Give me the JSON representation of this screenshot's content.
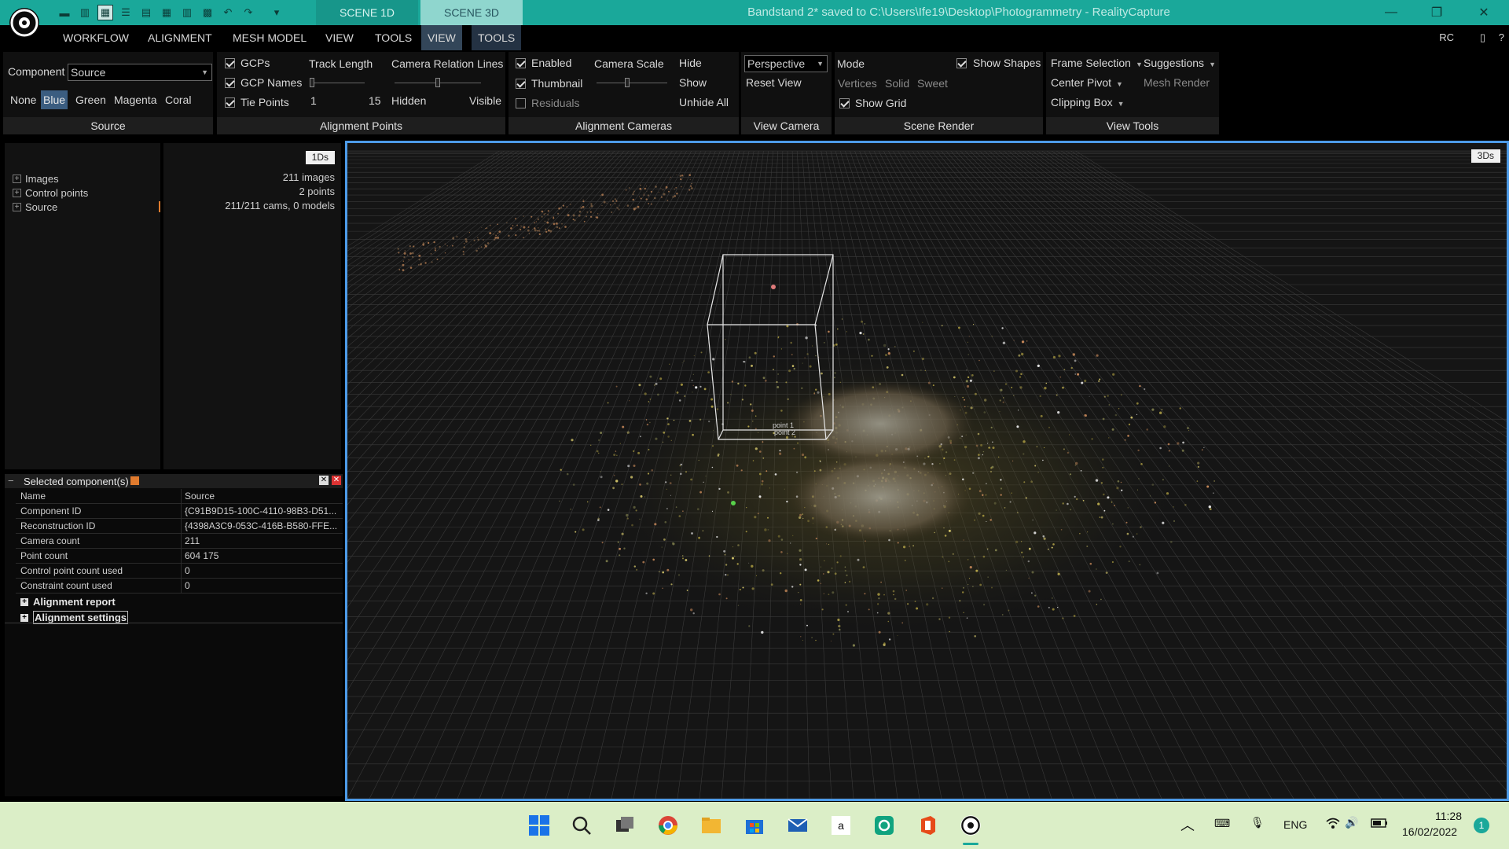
{
  "titlebar": {
    "scene_tabs": [
      "SCENE 1D",
      "SCENE 3D"
    ],
    "title": "Bandstand 2* saved to C:\\Users\\Ife19\\Desktop\\Photogrammetry - RealityCapture",
    "window_controls": [
      "minimize-icon",
      "restore-icon",
      "close-icon"
    ]
  },
  "menu": {
    "items": [
      "WORKFLOW",
      "ALIGNMENT",
      "MESH MODEL",
      "VIEW",
      "TOOLS",
      "VIEW",
      "TOOLS"
    ],
    "rc_label": "RC"
  },
  "ribbon": {
    "source": {
      "component_label": "Component",
      "component_value": "Source",
      "colors": [
        "None",
        "Blue",
        "Green",
        "Magenta",
        "Coral"
      ],
      "selected_color": "Blue",
      "title": "Source"
    },
    "alignment_points": {
      "checks": [
        "GCPs",
        "GCP Names",
        "Tie Points"
      ],
      "track_length_label": "Track Length",
      "track_min": "1",
      "track_max": "15",
      "relation_label": "Camera Relation Lines",
      "hidden": "Hidden",
      "visible": "Visible",
      "title": "Alignment Points"
    },
    "alignment_cameras": {
      "enabled": "Enabled",
      "thumbnail": "Thumbnail",
      "residuals": "Residuals",
      "camera_scale": "Camera Scale",
      "hide": "Hide",
      "show": "Show",
      "unhide_all": "Unhide All",
      "title": "Alignment Cameras"
    },
    "view_camera": {
      "projection": "Perspective",
      "reset_view": "Reset View",
      "title": "View Camera"
    },
    "scene_render": {
      "mode": "Mode",
      "modes": [
        "Vertices",
        "Solid",
        "Sweet"
      ],
      "show_shapes": "Show Shapes",
      "show_grid": "Show Grid",
      "title": "Scene Render"
    },
    "view_tools": {
      "frame_selection": "Frame Selection",
      "suggestions": "Suggestions",
      "center_pivot": "Center Pivot",
      "mesh_render": "Mesh Render",
      "clipping_box": "Clipping Box",
      "title": "View Tools"
    }
  },
  "tree": {
    "badge": "1Ds",
    "items": [
      {
        "label": "Images",
        "info": "211 images"
      },
      {
        "label": "Control points",
        "info": "2 points"
      },
      {
        "label": "Source",
        "info": "211/211 cams, 0 models"
      }
    ]
  },
  "properties": {
    "title": "Selected component(s)",
    "rows": [
      {
        "k": "Name",
        "v": "Source"
      },
      {
        "k": "Component ID",
        "v": "{C91B9D15-100C-4110-98B3-D51..."
      },
      {
        "k": "Reconstruction ID",
        "v": "{4398A3C9-053C-416B-B580-FFE..."
      },
      {
        "k": "Camera count",
        "v": "211"
      },
      {
        "k": "Point count",
        "v": "604 175"
      },
      {
        "k": "Control point count used",
        "v": "0"
      },
      {
        "k": "Constraint count used",
        "v": "0"
      }
    ],
    "sections": [
      "Alignment report",
      "Alignment settings"
    ]
  },
  "viewport": {
    "badge": "3Ds",
    "point_label_1": "point 1",
    "point_label_2": "point 2"
  },
  "taskbar": {
    "lang": "ENG",
    "time": "11:28",
    "date": "16/02/2022",
    "notification_count": "1"
  },
  "colors": {
    "accent": "#1aa89a",
    "viewport_border": "#4d9be8",
    "taskbar": "#dbeec7"
  }
}
